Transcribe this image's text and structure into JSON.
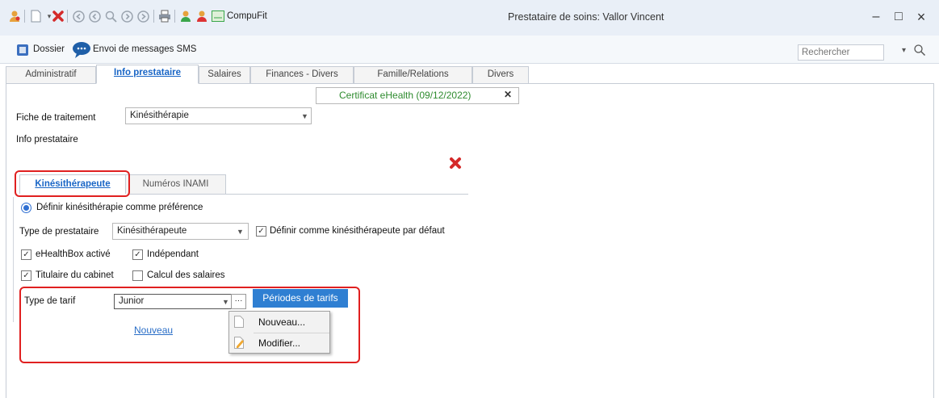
{
  "window": {
    "title": "Prestataire de soins: Vallor Vincent",
    "app_label": "CompuFit",
    "minimize": "–",
    "maximize": "□",
    "close": "×"
  },
  "toolbar": {
    "dossier_label": "Dossier",
    "sms_label": "Envoi de messages SMS",
    "search_placeholder": "Rechercher",
    "search_dropdown": "▾",
    "search_icon": "⚲"
  },
  "main_tabs": [
    "Administratif",
    "Info prestataire",
    "Salaires",
    "Finances - Divers",
    "Famille/Relations",
    "Divers"
  ],
  "active_tab": "Info prestataire",
  "certificate": {
    "text": "Certificat eHealth (09/12/2022)",
    "close": "✕"
  },
  "form": {
    "fiche_label": "Fiche de traitement",
    "fiche_value": "Kinésithérapie",
    "info_label": "Info prestataire"
  },
  "inner_tabs": [
    "Kinésithérapeute",
    "Numéros INAMI"
  ],
  "kine": {
    "radio_label": "Définir kinésithérapie comme préférence",
    "type_label": "Type de prestataire",
    "type_value": "Kinésithérapeute",
    "default_label": "Définir comme kinésithérapeute par défaut",
    "ehealthbox_label": "eHealthBox activé",
    "independant_label": "Indépendant",
    "titulaire_label": "Titulaire du cabinet",
    "calcul_label": "Calcul des salaires",
    "tarif_label": "Type de tarif",
    "tarif_value": "Junior",
    "ellipsis": "···",
    "periodes_button": "Périodes de tarifs",
    "nouveau_link": "Nouveau"
  },
  "context_menu": [
    "Nouveau...",
    "Modifier..."
  ],
  "colors": {
    "accent": "#2f7fd2",
    "highlight": "#e02020",
    "cert_text": "#2e8b2e",
    "link": "#2a6ec7"
  }
}
